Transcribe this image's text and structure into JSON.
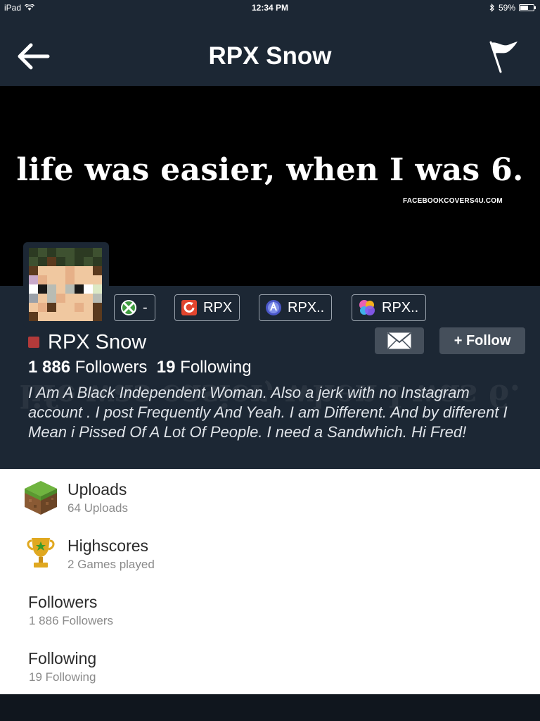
{
  "status_bar": {
    "device": "iPad",
    "time": "12:34 PM",
    "battery": "59%",
    "battery_level": 0.59
  },
  "nav": {
    "title": "RPX Snow",
    "icons": {
      "back": "back-arrow-icon",
      "report": "flag-icon"
    }
  },
  "cover": {
    "quote": "life was easier, when I was 6.",
    "watermark": "FACEBOOKCOVERS4U.COM"
  },
  "gamer_tags": [
    {
      "service": "xbox",
      "icon": "xbox-icon",
      "label": "-",
      "color": "#3f9b3f"
    },
    {
      "service": "sony",
      "icon": "sony-icon",
      "label": "RPX",
      "color": "#e2452e"
    },
    {
      "service": "playstation",
      "icon": "playstation-icon",
      "label": "RPX..",
      "color": "#4a57c9"
    },
    {
      "service": "game-center",
      "icon": "game-center-icon",
      "label": "RPX..",
      "color": "#e960b4"
    }
  ],
  "profile": {
    "name": "RPX Snow",
    "status_color": "#b23a3a",
    "followers_count": "1 886",
    "followers_label": "Followers",
    "following_count": "19",
    "following_label": "Following",
    "bio": "I Am A Black Independent Woman. Also a jerk with no Instagram account . I post Frequently And Yeah. I am Different. And by different I Mean i Pissed Of A Lot Of People. I need a Sandwhich. Hi Fred!",
    "follow_label": "+ Follow",
    "message_icon": "envelope-icon"
  },
  "menu": [
    {
      "icon": "grass-block-icon",
      "label": "Uploads",
      "sub": "64 Uploads"
    },
    {
      "icon": "trophy-icon",
      "label": "Highscores",
      "sub": "2 Games played"
    },
    {
      "icon": "",
      "label": "Followers",
      "sub": "1 886 Followers"
    },
    {
      "icon": "",
      "label": "Following",
      "sub": "19 Following"
    }
  ],
  "colors": {
    "bar": "#1c2734",
    "button": "#454f5b",
    "accent_status": "#b23a3a"
  }
}
